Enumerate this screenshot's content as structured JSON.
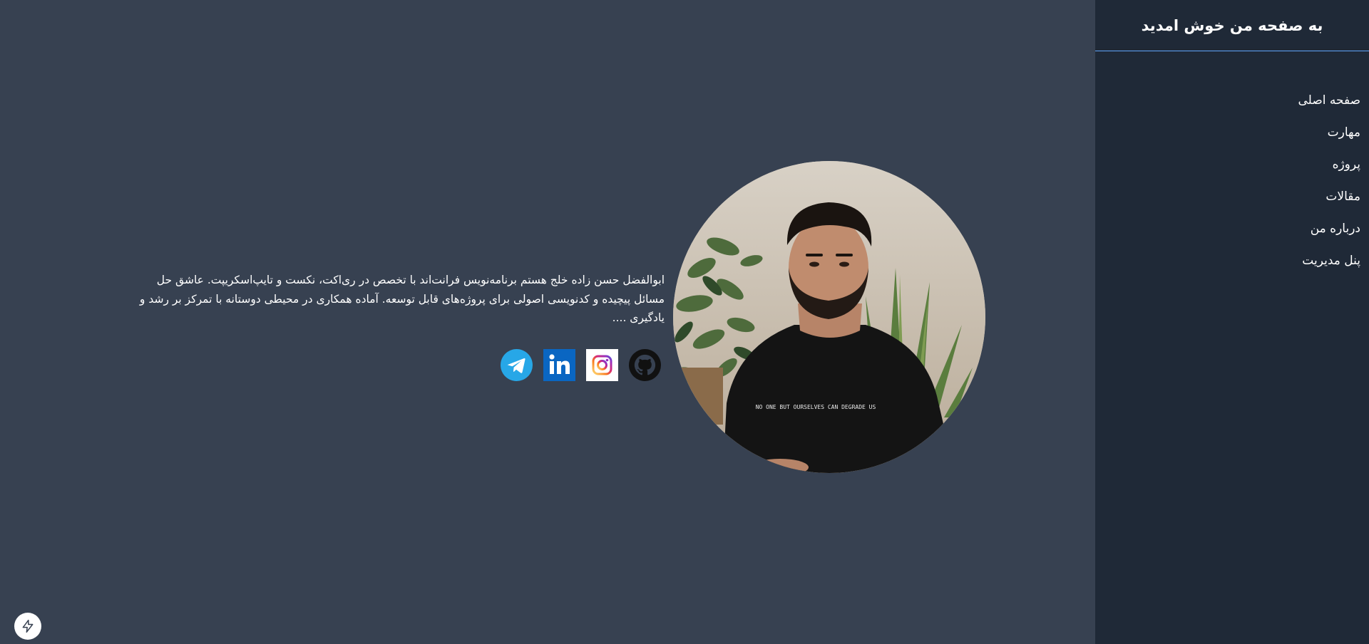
{
  "sidebar": {
    "title": "به صفحه من خوش امدید",
    "items": [
      {
        "label": "صفحه اصلی"
      },
      {
        "label": "مهارت"
      },
      {
        "label": "پروژه"
      },
      {
        "label": "مقالات"
      },
      {
        "label": "درباره من"
      },
      {
        "label": "پنل مدیریت"
      }
    ]
  },
  "main": {
    "intro": "ابوالفضل حسن زاده خلج هستم برنامه‌نویس فرانت‌اند با تخصص در ری‌اکت، نکست و تایپ‌اسکریپت. عاشق حل مسائل پیچیده و کدنویسی اصولی برای پروژه‌های قابل توسعه. آماده همکاری در محیطی دوستانه با تمرکز بر رشد و یادگیری ....",
    "photo": {
      "tshirt_text": "NO ONE BUT OURSELVES CAN DEGRADE US"
    },
    "socials": [
      {
        "icon": "github-icon"
      },
      {
        "icon": "instagram-icon"
      },
      {
        "icon": "linkedin-icon"
      },
      {
        "icon": "telegram-icon"
      }
    ]
  },
  "colors": {
    "page_bg": "#374151",
    "sidebar_bg": "#1f2937",
    "header_divider": "#60a5fa",
    "text": "#ffffff",
    "linkedin": "#0a66c2",
    "telegram": "#27a7e7"
  },
  "corner_badge": {
    "icon": "lightning-icon"
  }
}
